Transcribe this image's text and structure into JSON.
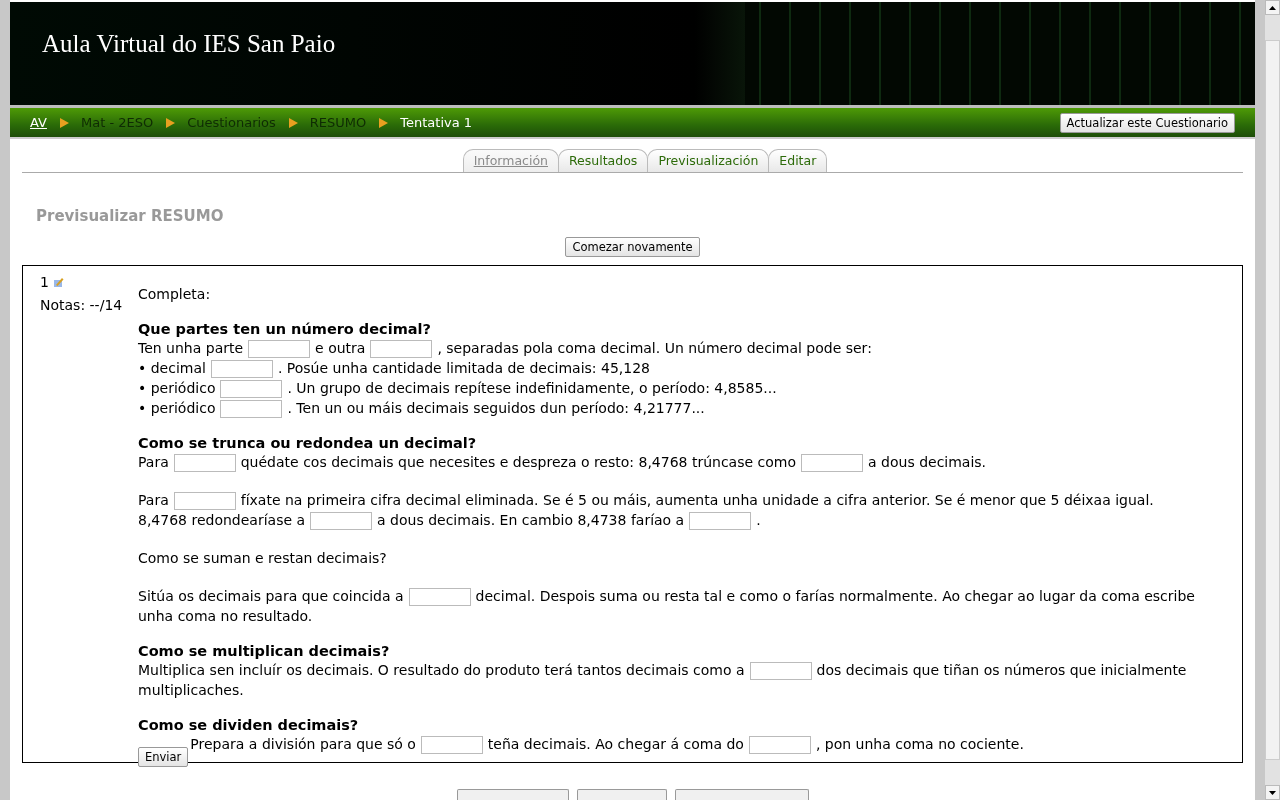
{
  "header": {
    "title": "Aula Virtual do IES San Paio"
  },
  "breadcrumb": [
    {
      "label": "AV",
      "kind": "link"
    },
    {
      "label": "Mat - 2ESO",
      "kind": "faded"
    },
    {
      "label": "Cuestionarios",
      "kind": "faded"
    },
    {
      "label": "RESUMO",
      "kind": "faded"
    },
    {
      "label": "Tentativa 1",
      "kind": "current"
    }
  ],
  "update_button": "Actualizar este Cuestionario",
  "tabs": [
    {
      "label": "Información",
      "selected": true
    },
    {
      "label": "Resultados",
      "selected": false
    },
    {
      "label": "Previsualización",
      "selected": false
    },
    {
      "label": "Editar",
      "selected": false
    }
  ],
  "page_heading": "Previsualizar RESUMO",
  "restart_button": "Comezar novamente",
  "question": {
    "number": "1",
    "grade": "Notas: --/14",
    "intro": "Completa:",
    "submit_button": "Enviar",
    "blocks": [
      {
        "kind": "heading",
        "text": "Que partes ten un número decimal?"
      },
      {
        "kind": "line",
        "segments": [
          {
            "kind": "text",
            "text": "Ten unha parte"
          },
          {
            "kind": "blank"
          },
          {
            "kind": "text",
            "text": "e outra"
          },
          {
            "kind": "blank"
          },
          {
            "kind": "text",
            "text": ", separadas pola coma decimal. Un número decimal pode ser:"
          }
        ]
      },
      {
        "kind": "line",
        "segments": [
          {
            "kind": "text",
            "text": "• decimal"
          },
          {
            "kind": "blank"
          },
          {
            "kind": "text",
            "text": ". Posúe unha cantidade limitada de decimais: 45,128"
          }
        ]
      },
      {
        "kind": "line",
        "segments": [
          {
            "kind": "text",
            "text": "• periódico"
          },
          {
            "kind": "blank"
          },
          {
            "kind": "text",
            "text": ". Un grupo de decimais repítese indefinidamente, o período: 4,8585..."
          }
        ]
      },
      {
        "kind": "line",
        "segments": [
          {
            "kind": "text",
            "text": "• periódico"
          },
          {
            "kind": "blank"
          },
          {
            "kind": "text",
            "text": ". Ten un ou máis decimais seguidos dun período: 4,21777..."
          }
        ]
      },
      {
        "kind": "heading",
        "text": "Como se trunca ou redondea un decimal?"
      },
      {
        "kind": "line",
        "segments": [
          {
            "kind": "text",
            "text": "Para"
          },
          {
            "kind": "blank"
          },
          {
            "kind": "text",
            "text": "quédate cos decimais que necesites e despreza o resto: 8,4768 trúncase como"
          },
          {
            "kind": "blank"
          },
          {
            "kind": "text",
            "text": "a dous decimais."
          }
        ]
      },
      {
        "kind": "paragraph",
        "segments": [
          {
            "kind": "text",
            "text": "Para"
          },
          {
            "kind": "blank"
          },
          {
            "kind": "text",
            "text": "fíxate na primeira cifra decimal eliminada. Se é 5 ou máis, aumenta unha unidade a cifra anterior. Se é menor que 5 déixaa igual."
          },
          {
            "kind": "break"
          },
          {
            "kind": "text",
            "text": "8,4768 redondearíase a"
          },
          {
            "kind": "blank"
          },
          {
            "kind": "text",
            "text": "a dous decimais. En cambio 8,4738 faríao a"
          },
          {
            "kind": "blank"
          },
          {
            "kind": "text",
            "text": "."
          }
        ]
      },
      {
        "kind": "paragraph",
        "segments": [
          {
            "kind": "text",
            "text": "Como se suman e restan decimais?"
          }
        ]
      },
      {
        "kind": "paragraph",
        "segments": [
          {
            "kind": "text",
            "text": "Sitúa os decimais para que coincida a"
          },
          {
            "kind": "blank"
          },
          {
            "kind": "text",
            "text": "decimal. Despois suma ou resta tal e como o farías normalmente. Ao chegar ao lugar da coma escribe"
          },
          {
            "kind": "break"
          },
          {
            "kind": "text",
            "text": "unha coma no resultado."
          }
        ]
      },
      {
        "kind": "heading",
        "text": "Como se multiplican decimais?"
      },
      {
        "kind": "line",
        "segments": [
          {
            "kind": "text",
            "text": "Multiplica sen incluír os decimais. O resultado do produto terá tantos decimais como a"
          },
          {
            "kind": "blank"
          },
          {
            "kind": "text",
            "text": "dos decimais que tiñan os números que inicialmente"
          },
          {
            "kind": "break"
          },
          {
            "kind": "text",
            "text": "multiplicaches."
          }
        ]
      },
      {
        "kind": "heading",
        "text": "Como se dividen decimais?"
      },
      {
        "kind": "final",
        "segments": [
          {
            "kind": "text",
            "text": "Prepara a división para que só o"
          },
          {
            "kind": "blank"
          },
          {
            "kind": "text",
            "text": "teña decimais. Ao chegar á coma do"
          },
          {
            "kind": "blank"
          },
          {
            "kind": "text",
            "text": ", pon unha coma no cociente."
          }
        ]
      }
    ]
  }
}
